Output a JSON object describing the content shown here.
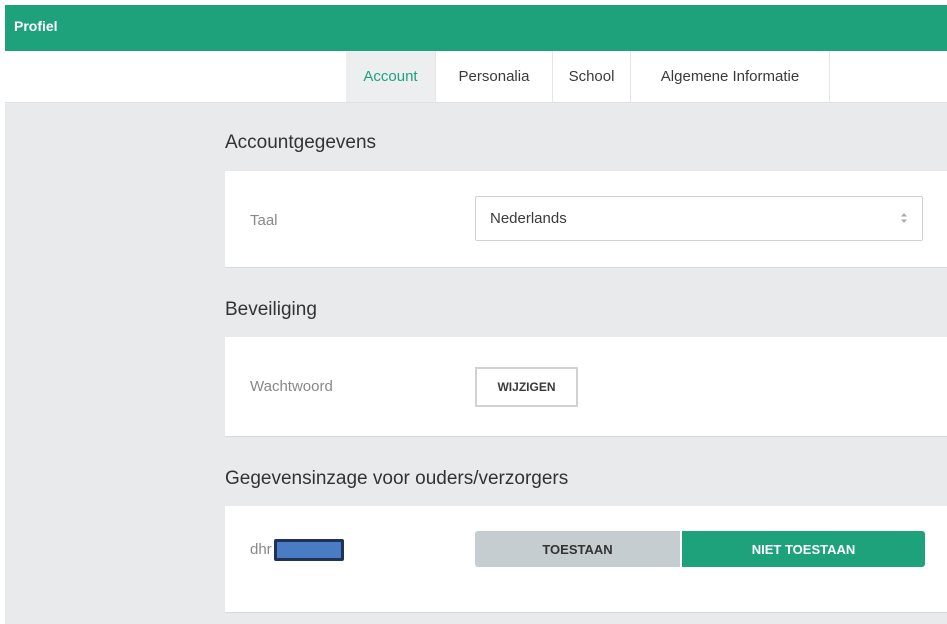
{
  "header": {
    "title": "Profiel",
    "color": "#1ea27c"
  },
  "tabs": [
    {
      "label": "Account",
      "active": true
    },
    {
      "label": "Personalia",
      "active": false
    },
    {
      "label": "School",
      "active": false
    },
    {
      "label": "Algemene Informatie",
      "active": false
    }
  ],
  "account": {
    "title": "Accountgegevens",
    "language_label": "Taal",
    "language_value": "Nederlands"
  },
  "security": {
    "title": "Beveiliging",
    "password_label": "Wachtwoord",
    "change_button": "WIJZIGEN"
  },
  "access": {
    "title": "Gegevensinzage voor ouders/verzorgers",
    "person_prefix": "dhr",
    "allow_label": "TOESTAAN",
    "deny_label": "NIET TOESTAAN",
    "selected": "NIET TOESTAAN"
  }
}
